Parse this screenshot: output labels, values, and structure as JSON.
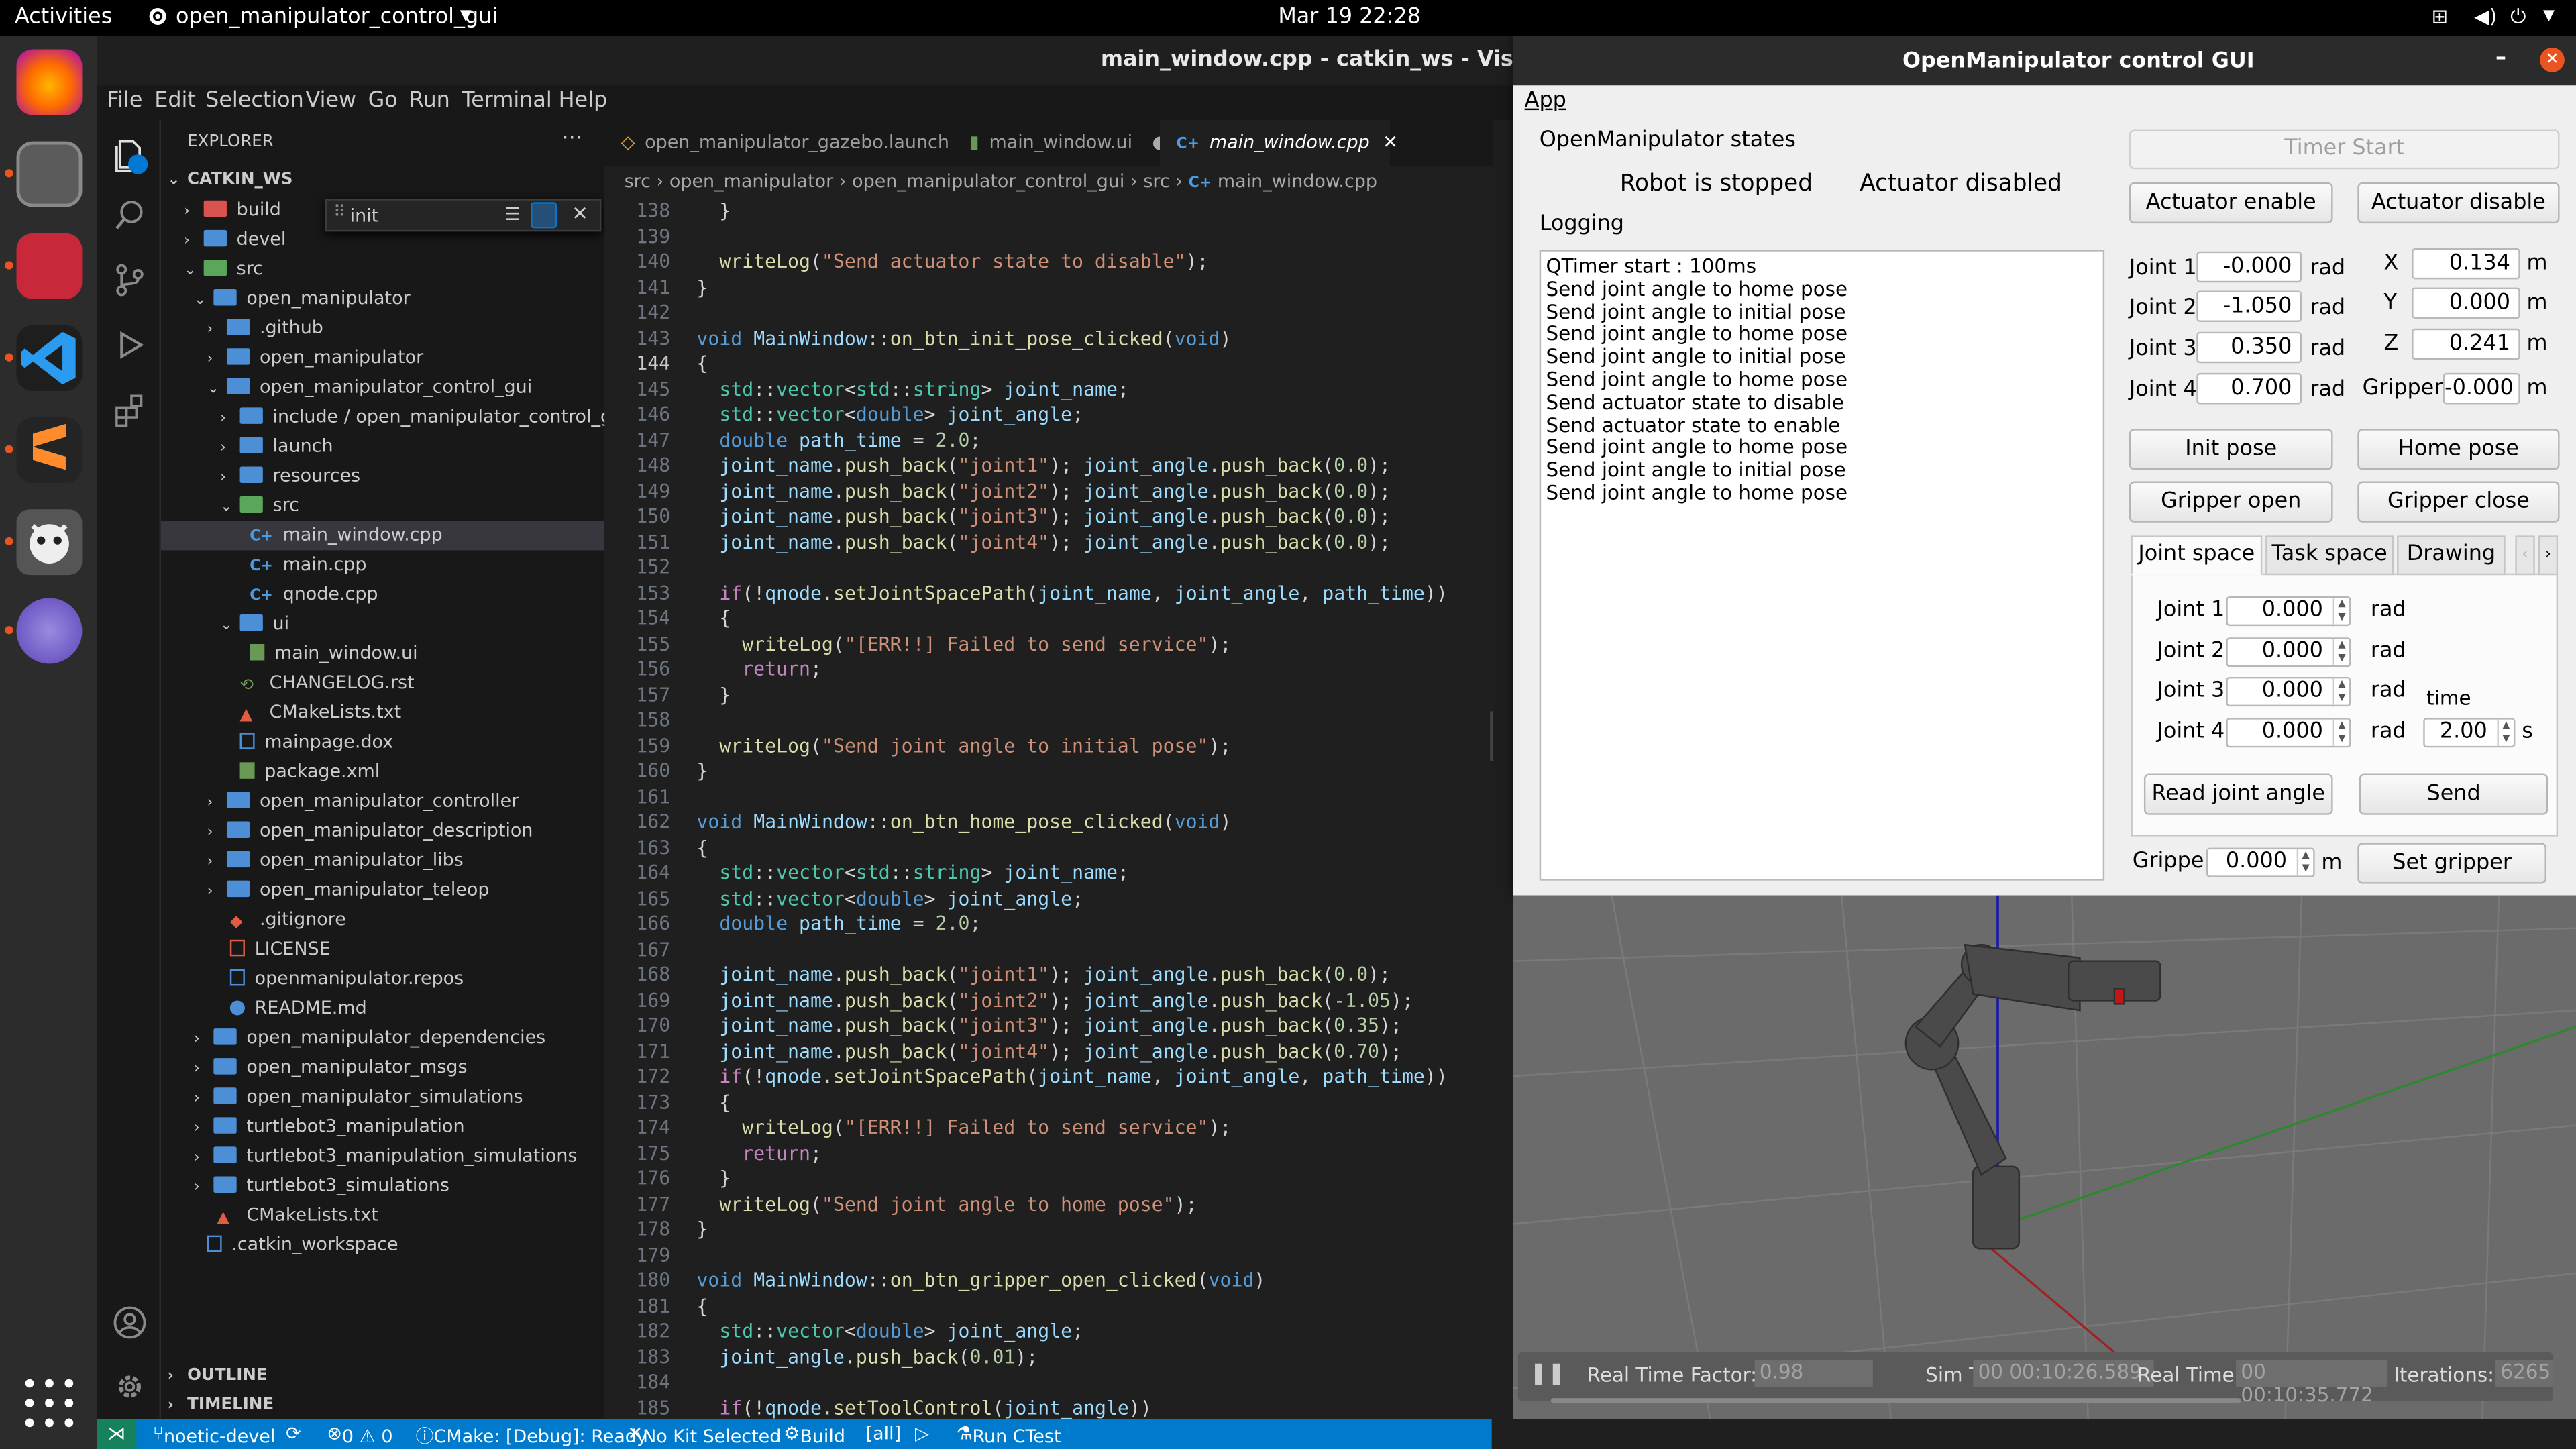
{
  "topbar": {
    "activities": "Activities",
    "app_name": "open_manipulator_control_gui",
    "clock": "Mar 19  22:28"
  },
  "vscode": {
    "window_title": "main_window.cpp - catkin_ws - Visual Studio",
    "menu": [
      "File",
      "Edit",
      "Selection",
      "View",
      "Go",
      "Run",
      "Terminal",
      "Help"
    ],
    "explorer": {
      "header": "EXPLORER",
      "root": "CATKIN_WS",
      "search_value": "init",
      "tree": [
        "build",
        "devel",
        "src",
        "open_manipulator",
        ".github",
        "open_manipulator",
        "open_manipulator_control_gui",
        "include / open_manipulator_control_gui",
        "launch",
        "resources",
        "src",
        "main_window.cpp",
        "main.cpp",
        "qnode.cpp",
        "ui",
        "main_window.ui",
        "CHANGELOG.rst",
        "CMakeLists.txt",
        "mainpage.dox",
        "package.xml",
        "open_manipulator_controller",
        "open_manipulator_description",
        "open_manipulator_libs",
        "open_manipulator_teleop",
        ".gitignore",
        "LICENSE",
        "openmanipulator.repos",
        "README.md",
        "open_manipulator_dependencies",
        "open_manipulator_msgs",
        "open_manipulator_simulations",
        "turtlebot3_manipulation",
        "turtlebot3_manipulation_simulations",
        "turtlebot3_simulations",
        "CMakeLists.txt",
        ".catkin_workspace"
      ],
      "outline": "OUTLINE",
      "timeline": "TIMELINE"
    },
    "tabs": [
      "open_manipulator_gazebo.launch",
      "main_window.ui",
      "main_window.cpp"
    ],
    "breadcrumb": [
      "src",
      "open_manipulator",
      "open_manipulator_control_gui",
      "src",
      "main_window.cpp"
    ],
    "code_lines": [
      {
        "n": "138",
        "t": "  }"
      },
      {
        "n": "139",
        "t": ""
      },
      {
        "n": "140",
        "t": "  writeLog(\"Send actuator state to disable\");"
      },
      {
        "n": "141",
        "t": "}"
      },
      {
        "n": "142",
        "t": ""
      },
      {
        "n": "143",
        "t": "void MainWindow::on_btn_init_pose_clicked(void)"
      },
      {
        "n": "144",
        "t": "{"
      },
      {
        "n": "145",
        "t": "  std::vector<std::string> joint_name;"
      },
      {
        "n": "146",
        "t": "  std::vector<double> joint_angle;"
      },
      {
        "n": "147",
        "t": "  double path_time = 2.0;"
      },
      {
        "n": "148",
        "t": "  joint_name.push_back(\"joint1\"); joint_angle.push_back(0.0);"
      },
      {
        "n": "149",
        "t": "  joint_name.push_back(\"joint2\"); joint_angle.push_back(0.0);"
      },
      {
        "n": "150",
        "t": "  joint_name.push_back(\"joint3\"); joint_angle.push_back(0.0);"
      },
      {
        "n": "151",
        "t": "  joint_name.push_back(\"joint4\"); joint_angle.push_back(0.0);"
      },
      {
        "n": "152",
        "t": ""
      },
      {
        "n": "153",
        "t": "  if(!qnode.setJointSpacePath(joint_name, joint_angle, path_time))"
      },
      {
        "n": "154",
        "t": "  {"
      },
      {
        "n": "155",
        "t": "    writeLog(\"[ERR!!] Failed to send service\");"
      },
      {
        "n": "156",
        "t": "    return;"
      },
      {
        "n": "157",
        "t": "  }"
      },
      {
        "n": "158",
        "t": ""
      },
      {
        "n": "159",
        "t": "  writeLog(\"Send joint angle to initial pose\");"
      },
      {
        "n": "160",
        "t": "}"
      },
      {
        "n": "161",
        "t": ""
      },
      {
        "n": "162",
        "t": "void MainWindow::on_btn_home_pose_clicked(void)"
      },
      {
        "n": "163",
        "t": "{"
      },
      {
        "n": "164",
        "t": "  std::vector<std::string> joint_name;"
      },
      {
        "n": "165",
        "t": "  std::vector<double> joint_angle;"
      },
      {
        "n": "166",
        "t": "  double path_time = 2.0;"
      },
      {
        "n": "167",
        "t": ""
      },
      {
        "n": "168",
        "t": "  joint_name.push_back(\"joint1\"); joint_angle.push_back(0.0);"
      },
      {
        "n": "169",
        "t": "  joint_name.push_back(\"joint2\"); joint_angle.push_back(-1.05);"
      },
      {
        "n": "170",
        "t": "  joint_name.push_back(\"joint3\"); joint_angle.push_back(0.35);"
      },
      {
        "n": "171",
        "t": "  joint_name.push_back(\"joint4\"); joint_angle.push_back(0.70);"
      },
      {
        "n": "172",
        "t": "  if(!qnode.setJointSpacePath(joint_name, joint_angle, path_time))"
      },
      {
        "n": "173",
        "t": "  {"
      },
      {
        "n": "174",
        "t": "    writeLog(\"[ERR!!] Failed to send service\");"
      },
      {
        "n": "175",
        "t": "    return;"
      },
      {
        "n": "176",
        "t": "  }"
      },
      {
        "n": "177",
        "t": "  writeLog(\"Send joint angle to home pose\");"
      },
      {
        "n": "178",
        "t": "}"
      },
      {
        "n": "179",
        "t": ""
      },
      {
        "n": "180",
        "t": "void MainWindow::on_btn_gripper_open_clicked(void)"
      },
      {
        "n": "181",
        "t": "{"
      },
      {
        "n": "182",
        "t": "  std::vector<double> joint_angle;"
      },
      {
        "n": "183",
        "t": "  joint_angle.push_back(0.01);"
      },
      {
        "n": "184",
        "t": ""
      },
      {
        "n": "185",
        "t": "  if(!qnode.setToolControl(joint_angle))"
      }
    ],
    "status": {
      "branch": "noetic-devel",
      "problems": "0 ⚠ 0",
      "cmake": "CMake: [Debug]: Ready",
      "kit": "No Kit Selected",
      "build": "Build",
      "all": "[all]",
      "ctest": "Run CTest"
    }
  },
  "gui": {
    "title": "OpenManipulator control GUI",
    "menu": "App",
    "states_label": "OpenManipulator states",
    "robot_state": "Robot is stopped",
    "actuator_state": "Actuator disabled",
    "logging_label": "Logging",
    "log": [
      "QTimer start : 100ms",
      "Send joint angle to home pose",
      "Send joint angle to initial pose",
      "Send joint angle to home pose",
      "Send joint angle to initial pose",
      "Send joint angle to home pose",
      "Send actuator state to disable",
      "Send actuator state to enable",
      "Send joint angle to home pose",
      "Send joint angle to initial pose",
      "Send joint angle to home pose"
    ],
    "timer_start": "Timer Start",
    "actuator_enable": "Actuator enable",
    "actuator_disable": "Actuator disable",
    "joints": [
      {
        "label": "Joint 1",
        "value": "-0.000",
        "unit": "rad"
      },
      {
        "label": "Joint 2",
        "value": "-1.050",
        "unit": "rad"
      },
      {
        "label": "Joint 3",
        "value": "0.350",
        "unit": "rad"
      },
      {
        "label": "Joint 4",
        "value": "0.700",
        "unit": "rad"
      }
    ],
    "cartesian": [
      {
        "label": "X",
        "value": "0.134",
        "unit": "m"
      },
      {
        "label": "Y",
        "value": "0.000",
        "unit": "m"
      },
      {
        "label": "Z",
        "value": "0.241",
        "unit": "m"
      },
      {
        "label": "Gripper",
        "value": "-0.000",
        "unit": "m"
      }
    ],
    "init_pose": "Init pose",
    "home_pose": "Home pose",
    "gripper_open": "Gripper open",
    "gripper_close": "Gripper close",
    "tabs": [
      "Joint space",
      "Task space",
      "Drawing"
    ],
    "joint_inputs": [
      {
        "label": "Joint 1",
        "value": "0.000",
        "unit": "rad"
      },
      {
        "label": "Joint 2",
        "value": "0.000",
        "unit": "rad"
      },
      {
        "label": "Joint 3",
        "value": "0.000",
        "unit": "rad"
      },
      {
        "label": "Joint 4",
        "value": "0.000",
        "unit": "rad"
      }
    ],
    "time_label": "time",
    "time_value": "2.00",
    "time_unit": "s",
    "read_joint_angle": "Read joint angle",
    "send": "Send",
    "gripper_label": "Gripper",
    "gripper_value": "0.000",
    "gripper_unit": "m",
    "set_gripper": "Set gripper"
  },
  "gazebo": {
    "rtf_label": "Real Time Factor:",
    "rtf": "0.98",
    "sim_label": "Sim Time:",
    "sim": "00 00:10:26.589",
    "real_label": "Real Time:",
    "real": "00 00:10:35.772",
    "iter_label": "Iterations:",
    "iter": "6265"
  }
}
